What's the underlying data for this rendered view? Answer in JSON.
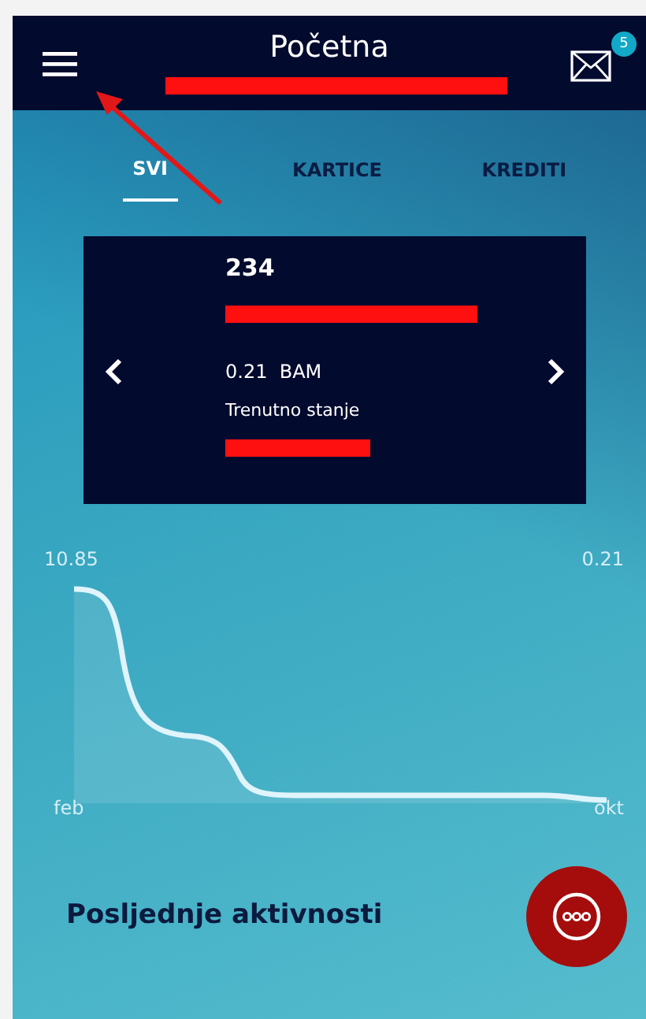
{
  "header": {
    "title": "Početna",
    "message_count": "5"
  },
  "tabs": [
    {
      "label": "SVI",
      "selected": true
    },
    {
      "label": "KARTICE",
      "selected": false
    },
    {
      "label": "KREDITI",
      "selected": false
    }
  ],
  "account_card": {
    "name": "234",
    "amount": "0.21  BAM",
    "balance_label": "Trenutno stanje"
  },
  "chart": {
    "start_value": "10.85",
    "end_value": "0.21",
    "start_month": "feb",
    "end_month": "okt"
  },
  "section_title": "Posljednje aktivnosti"
}
